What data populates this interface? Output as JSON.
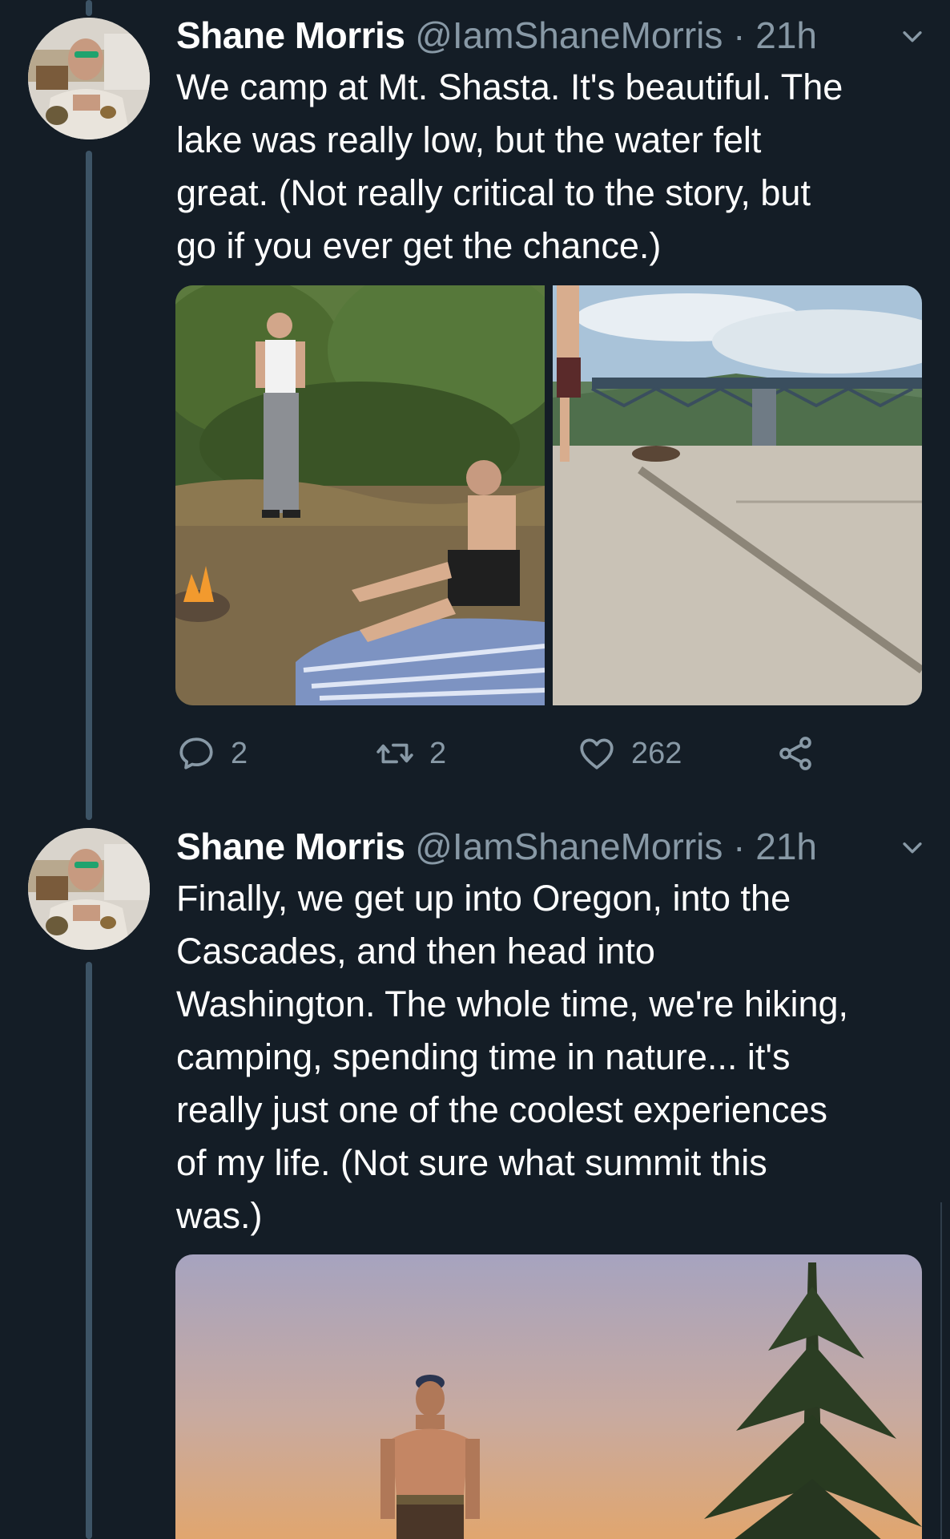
{
  "tweets": [
    {
      "name": "Shane Morris",
      "handle": "@IamShaneMorris",
      "separator": "·",
      "time": "21h",
      "text": "We camp at Mt. Shasta. It's beautiful. The\nlake was really low, but the water felt\ngreat. (Not really critical to the story, but\ngo if you ever get the chance.)",
      "actions": {
        "replies": "2",
        "retweets": "2",
        "likes": "262"
      }
    },
    {
      "name": "Shane Morris",
      "handle": "@IamShaneMorris",
      "separator": "·",
      "time": "21h",
      "text": "Finally, we get up into Oregon, into the\nCascades, and then head into\nWashington. The whole time, we're hiking,\ncamping, spending time in nature... it's\nreally just one of the coolest experiences\nof my life. (Not sure what summit this\nwas.)"
    }
  ],
  "icons": {
    "reply": "reply-icon",
    "retweet": "retweet-icon",
    "like": "heart-icon",
    "share": "share-icon",
    "more": "chevron-down-icon"
  },
  "colors": {
    "background": "#141d26",
    "secondary_text": "#8899a6",
    "thread_line": "#3d5466"
  }
}
